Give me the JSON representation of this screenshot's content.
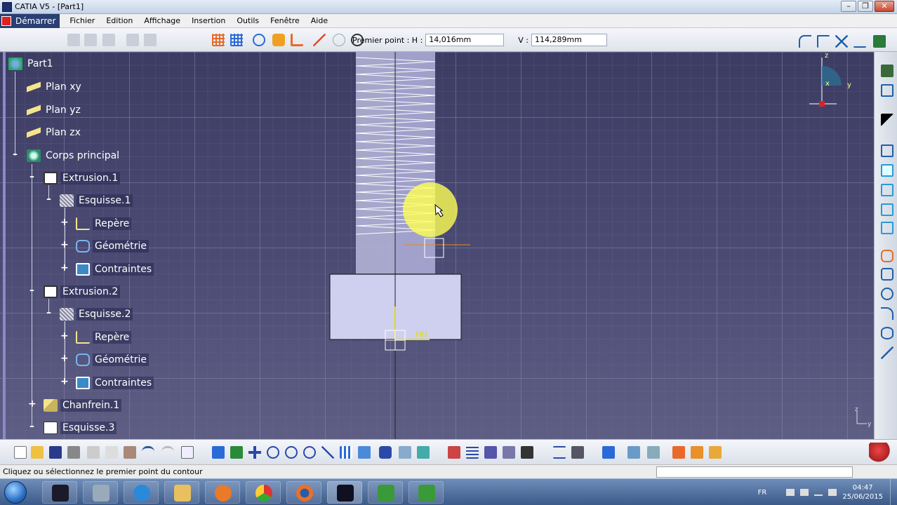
{
  "window": {
    "title": "CATIA V5 - [Part1]",
    "controls": {
      "minimize": "–",
      "restore": "❐",
      "close": "✕"
    }
  },
  "menubar": {
    "start": "Démarrer",
    "items": [
      "Fichier",
      "Edition",
      "Affichage",
      "Insertion",
      "Outils",
      "Fenêtre",
      "Aide"
    ]
  },
  "sketch_tools": {
    "first_point_label": "Premier point : H :",
    "h_value": "14,016mm",
    "v_label": "V :",
    "v_value": "114,289mm"
  },
  "tree": {
    "root": "Part1",
    "planes": [
      "Plan xy",
      "Plan yz",
      "Plan zx"
    ],
    "body": "Corps principal",
    "nodes": {
      "extrusion1": "Extrusion.1",
      "esquisse1": "Esquisse.1",
      "repere1": "Repère",
      "geometrie1": "Géométrie",
      "contraintes1": "Contraintes",
      "extrusion2": "Extrusion.2",
      "esquisse2": "Esquisse.2",
      "repere2": "Repère",
      "geometrie2": "Géométrie",
      "contraintes2": "Contraintes",
      "chanfrein1": "Chanfrein.1",
      "esquisse3": "Esquisse.3"
    }
  },
  "viewport": {
    "axis_labels": {
      "z": "z",
      "y": "y",
      "x": "x"
    },
    "constraint_label": "HH",
    "corner_axis": {
      "z": "z",
      "y": "y"
    }
  },
  "statusbar": {
    "message": "Cliquez ou sélectionnez le premier point du contour"
  },
  "taskbar": {
    "language": "FR",
    "time": "04:47",
    "date": "25/06/2015"
  },
  "colors": {
    "viewport_bg": "#3f3f66",
    "highlight": "#ffff55",
    "constraint": "#e0e000",
    "sketch_line": "#ffffff"
  }
}
